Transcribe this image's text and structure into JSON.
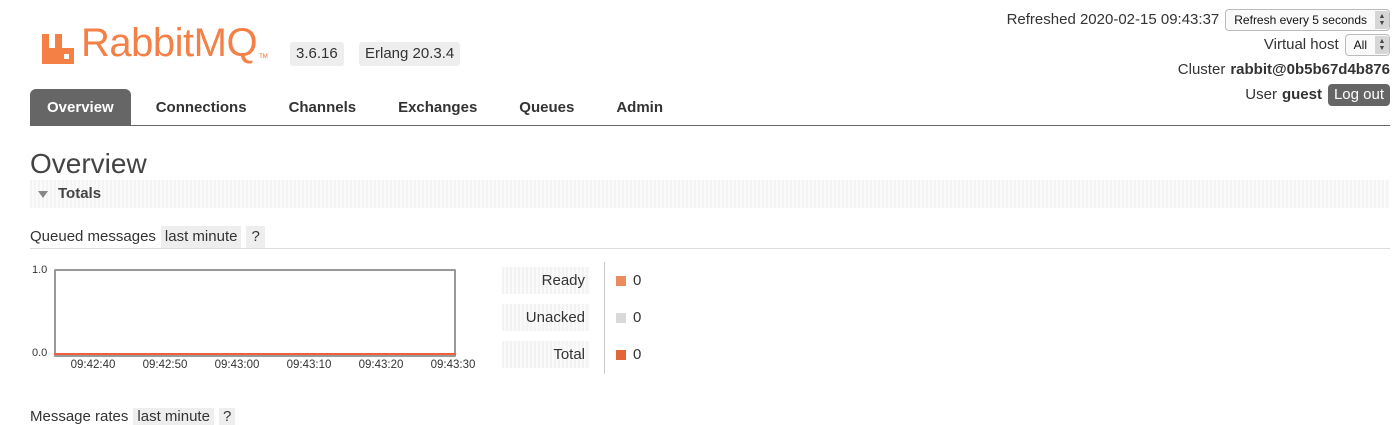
{
  "app": {
    "name": "RabbitMQ",
    "version": "3.6.16",
    "erlang": "Erlang 20.3.4"
  },
  "header": {
    "refreshed_label": "Refreshed 2020-02-15 09:43:37",
    "refresh_select": "Refresh every 5 seconds",
    "vhost_label": "Virtual host",
    "vhost_select": "All",
    "cluster_label": "Cluster",
    "cluster_name": "rabbit@0b5b67d4b876",
    "user_label": "User",
    "user_name": "guest",
    "logout_label": "Log out"
  },
  "tabs": [
    {
      "label": "Overview",
      "active": true
    },
    {
      "label": "Connections"
    },
    {
      "label": "Channels"
    },
    {
      "label": "Exchanges"
    },
    {
      "label": "Queues"
    },
    {
      "label": "Admin"
    }
  ],
  "page": {
    "title": "Overview",
    "section": "Totals",
    "queued_label": "Queued messages",
    "range_chip": "last minute",
    "help_chip": "?",
    "next_label": "Message rates",
    "next_chip": "last minute",
    "next_help": "?"
  },
  "chart": {
    "y_max": "1.0",
    "y_min": "0.0",
    "x_ticks": [
      "09:42:40",
      "09:42:50",
      "09:43:00",
      "09:43:10",
      "09:43:20",
      "09:43:30"
    ],
    "legend": [
      {
        "label": "Ready",
        "value": "0",
        "color": "#ec8a60"
      },
      {
        "label": "Unacked",
        "value": "0",
        "color": "#d9d9d9"
      },
      {
        "label": "Total",
        "value": "0",
        "color": "#e2663a"
      }
    ]
  },
  "colors": {
    "brand": "#f26a26",
    "tab_active": "#666666",
    "series_line": "#ef5f3e"
  }
}
